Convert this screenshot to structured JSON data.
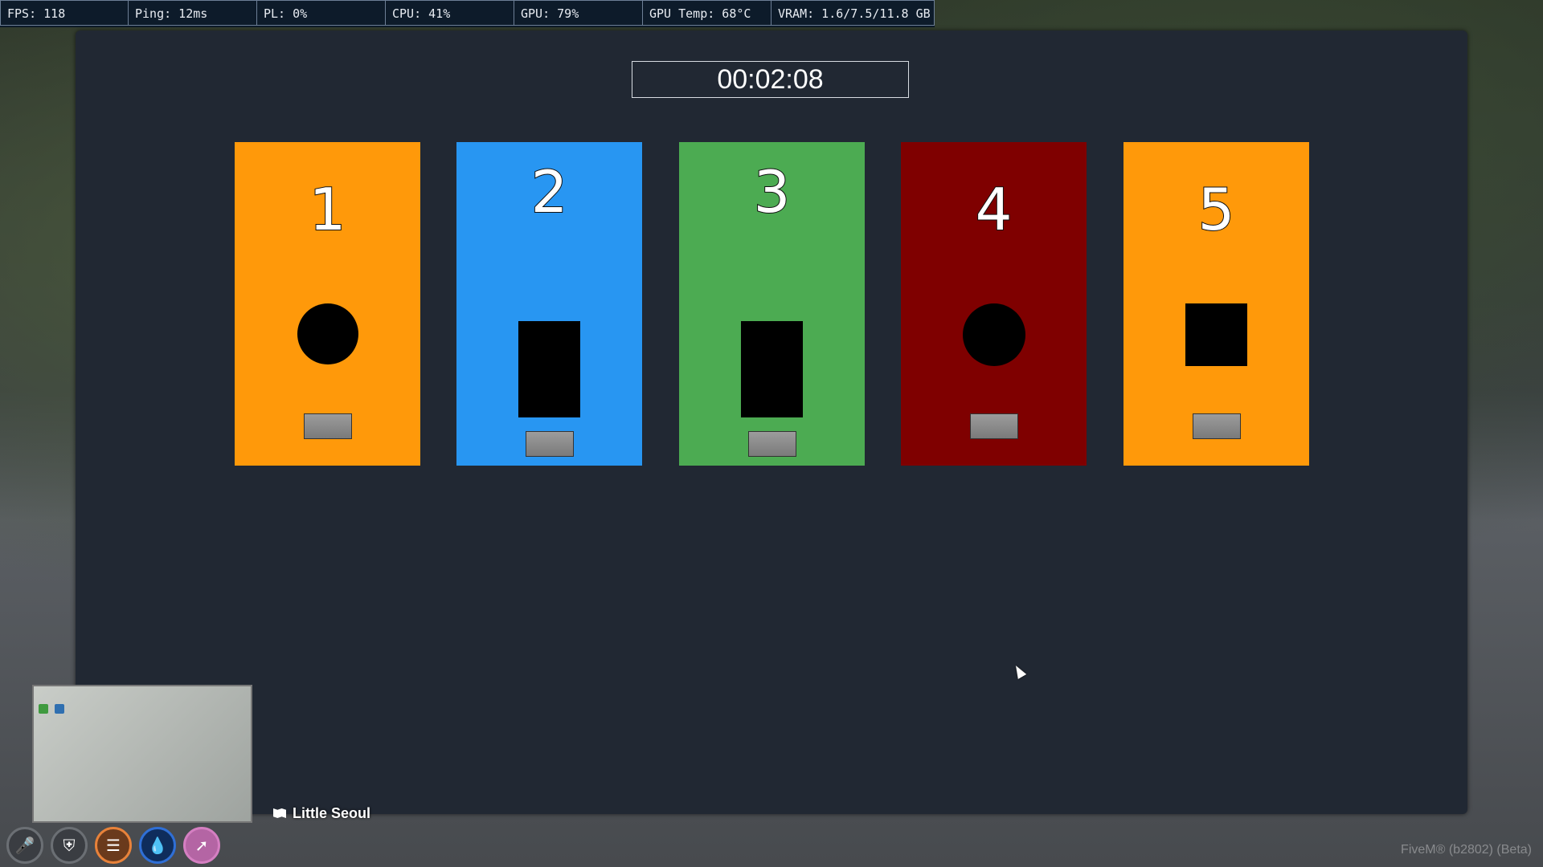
{
  "perf_overlay": {
    "fps": "FPS: 118",
    "ping": "Ping: 12ms",
    "pl": "PL: 0%",
    "cpu": "CPU: 41%",
    "gpu": "GPU: 79%",
    "gpu_temp": "GPU Temp: 68°C",
    "vram": "VRAM: 1.6/7.5/11.8 GB"
  },
  "minigame": {
    "timer": "00:02:08",
    "cards": [
      {
        "number": "1",
        "color": "#FF990A",
        "shape": "circle"
      },
      {
        "number": "2",
        "color": "#2896F2",
        "shape": "tall-rectangle"
      },
      {
        "number": "3",
        "color": "#4CAB52",
        "shape": "tall-rectangle"
      },
      {
        "number": "4",
        "color": "#7F0000",
        "shape": "circle"
      },
      {
        "number": "5",
        "color": "#FF990A",
        "shape": "square"
      }
    ]
  },
  "hud": {
    "street": "Little Seoul",
    "status_icons": [
      {
        "name": "microphone-icon",
        "color": "#6b6f74"
      },
      {
        "name": "shield-icon",
        "color": "#6b6f74"
      },
      {
        "name": "burger-icon",
        "color": "#e8823a"
      },
      {
        "name": "water-drop-icon",
        "color": "#2f6fd6"
      },
      {
        "name": "stamina-icon",
        "color": "#d57fc2"
      }
    ],
    "brand": "FiveM® (b2802) (Beta)"
  }
}
